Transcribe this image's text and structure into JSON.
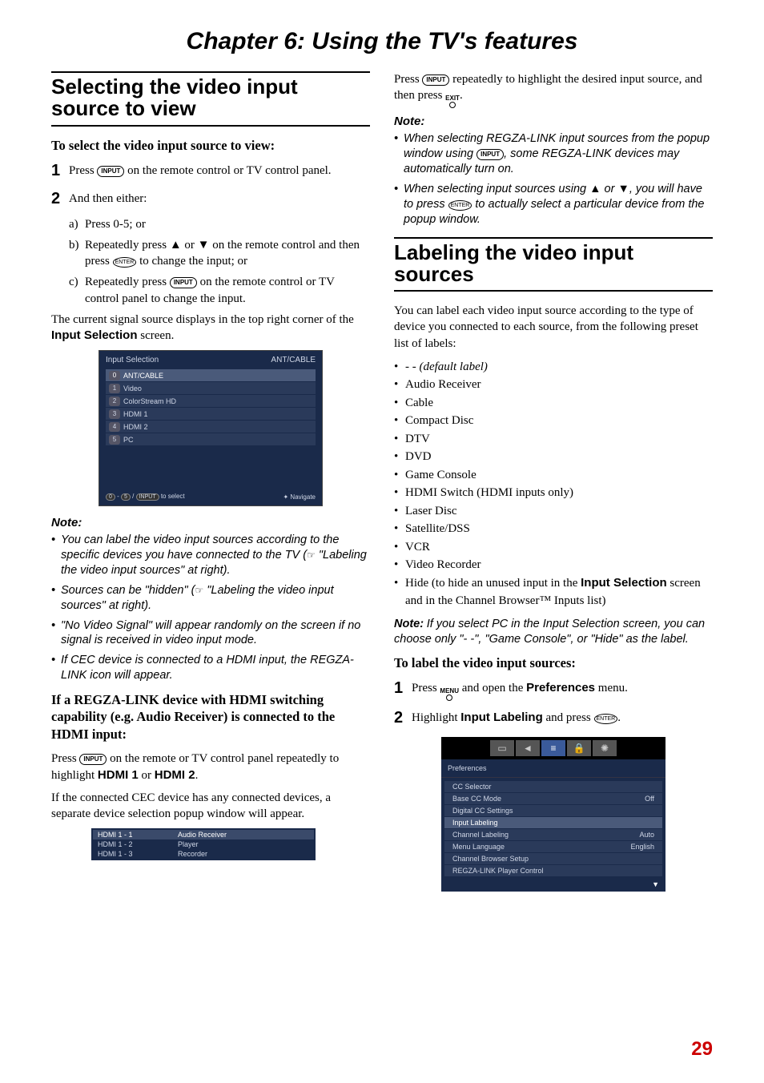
{
  "chapter_title": "Chapter 6: Using the TV's features",
  "left": {
    "section1_heading": "Selecting the video input source to view",
    "to_select": "To select the video input source to view:",
    "step1": "on the remote control or TV control panel.",
    "step1_prefix": "Press",
    "step2": "And then either:",
    "sub_a": "Press 0-5; or",
    "sub_b_prefix": "Repeatedly press",
    "sub_b_mid": "on the remote control and then press",
    "sub_b_end": "to change the input; or",
    "sub_c_prefix": "Repeatedly press",
    "sub_c_end": "on the remote control or TV control panel to change the input.",
    "current_signal": "The current signal source displays in the top right corner of the",
    "input_selection_bold": "Input Selection",
    "screen_suffix": " screen.",
    "note_label": "Note:",
    "note1": "You can label the video input sources according to the specific devices you have connected to the TV (",
    "note1_xref": "\"Labeling the video input sources\" at right).",
    "note2": "Sources can be \"hidden\" (",
    "note2_xref": "\"Labeling the video input sources\" at right).",
    "note3": "\"No Video Signal\" will appear randomly on the screen if no signal is received in video input mode.",
    "note4": "If CEC device is connected to a HDMI input, the REGZA-LINK icon will appear.",
    "regza_heading": "If a REGZA-LINK device with HDMI switching capability (e.g. Audio Receiver) is connected to the HDMI input:",
    "regza_p1_a": "Press",
    "regza_p1_b": "on the remote or TV control panel repeatedly to highlight",
    "hdmi1": "HDMI 1",
    "or": " or ",
    "hdmi2": "HDMI 2",
    "regza_p2": "If the connected CEC device has any connected devices, a separate device selection popup window will appear.",
    "osd1": {
      "title": "Input Selection",
      "current": "ANT/CABLE",
      "rows": [
        {
          "n": "0",
          "t": "ANT/CABLE"
        },
        {
          "n": "1",
          "t": "Video"
        },
        {
          "n": "2",
          "t": "ColorStream HD"
        },
        {
          "n": "3",
          "t": "HDMI 1"
        },
        {
          "n": "4",
          "t": "HDMI 2"
        },
        {
          "n": "5",
          "t": "PC"
        }
      ],
      "hint_l": "to select",
      "hint_r": "Navigate",
      "hint_input": "INPUT"
    },
    "popup": [
      {
        "l": "HDMI 1 - 1",
        "r": "Audio Receiver"
      },
      {
        "l": "HDMI 1 - 2",
        "r": "Player"
      },
      {
        "l": "HDMI 1 - 3",
        "r": "Recorder"
      }
    ]
  },
  "right": {
    "top_p_a": "Press",
    "top_p_b": "repeatedly to highlight the desired input source, and then press",
    "note_label": "Note:",
    "rnote1_a": "When selecting REGZA-LINK input sources from the popup window using",
    "rnote1_b": ", some REGZA-LINK devices may automatically turn on.",
    "rnote2_a": "When selecting input sources using",
    "rnote2_b": ", you will have to press",
    "rnote2_c": "to actually select a particular device from the popup window.",
    "section2_heading": "Labeling the video input sources",
    "intro": "You can label each video input source according to the type of device you connected to each source, from the following preset list of labels:",
    "labels": [
      "- - (default label)",
      "Audio Receiver",
      "Cable",
      "Compact Disc",
      "DTV",
      "DVD",
      "Game Console",
      "HDMI Switch (HDMI inputs only)",
      "Laser Disc",
      "Satellite/DSS",
      "VCR",
      "Video Recorder"
    ],
    "hide_a": "Hide (to hide an unused input in the ",
    "hide_b": "Input Selection",
    "hide_c": " screen and in the Channel Browser™ Inputs list)",
    "pc_note": "If you select PC in the Input Selection screen, you can choose only \"- -\", \"Game Console\", or \"Hide\" as the label.",
    "note_bold": "Note:",
    "to_label": "To label the video input sources:",
    "rstep1_a": "Press",
    "rstep1_b": "and open the",
    "rstep1_c": "Preferences",
    "rstep1_d": "menu.",
    "rstep2_a": "Highlight",
    "rstep2_b": "Input Labeling",
    "rstep2_c": "and press",
    "prefs": {
      "title": "Preferences",
      "rows": [
        {
          "l": "CC Selector",
          "r": ""
        },
        {
          "l": "Base CC Mode",
          "r": "Off"
        },
        {
          "l": "Digital CC Settings",
          "r": ""
        },
        {
          "l": "Input Labeling",
          "r": ""
        },
        {
          "l": "Channel Labeling",
          "r": "Auto"
        },
        {
          "l": "Menu Language",
          "r": "English"
        },
        {
          "l": "Channel Browser Setup",
          "r": ""
        },
        {
          "l": "REGZA-LINK Player Control",
          "r": ""
        }
      ]
    }
  },
  "keys": {
    "input": "INPUT",
    "enter": "ENTER",
    "exit": "EXIT",
    "menu": "MENU"
  },
  "page_number": "29"
}
